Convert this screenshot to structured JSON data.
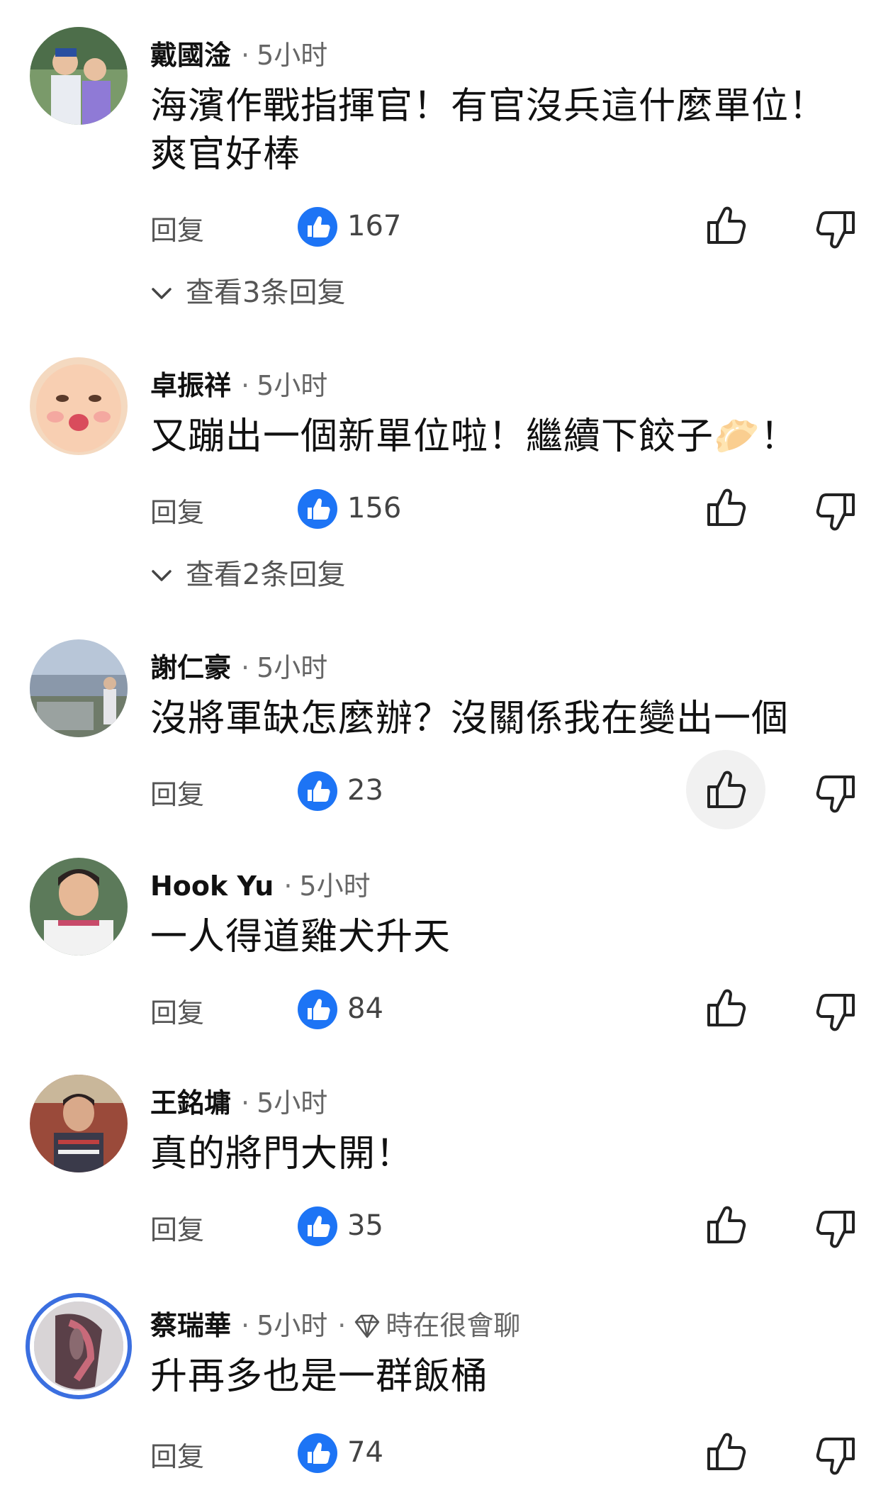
{
  "colors": {
    "like_blue": "#1d74f5",
    "text": "#111111",
    "muted": "#666666",
    "ring_blue": "#3b6fe0"
  },
  "icons": {
    "like_badge": "thumbs-up-badge-icon",
    "thumb_up": "thumb-up-outline-icon",
    "thumb_down": "thumb-down-outline-icon",
    "expand": "chevron-down-icon",
    "badge": "diamond-icon"
  },
  "comments": [
    {
      "author": "戴國淦",
      "time": "5小时",
      "text": "海濱作戰指揮官！有官沒兵這什麼單位！爽官好棒",
      "reply_label": "回复",
      "likes": "167",
      "view_replies": "查看3条回复"
    },
    {
      "author": "卓振祥",
      "time": "5小时",
      "text": "又蹦出一個新單位啦！繼續下餃子🥟！",
      "reply_label": "回复",
      "likes": "156",
      "view_replies": "查看2条回复"
    },
    {
      "author": "謝仁豪",
      "time": "5小时",
      "text": "沒將軍缺怎麼辦？沒關係我在變出一個",
      "reply_label": "回复",
      "likes": "23"
    },
    {
      "author": "Hook Yu",
      "time": "5小时",
      "text": "一人得道雞犬升天",
      "reply_label": "回复",
      "likes": "84"
    },
    {
      "author": "王銘墉",
      "time": "5小时",
      "text": "真的將門大開！",
      "reply_label": "回复",
      "likes": "35"
    },
    {
      "author": "蔡瑞華",
      "time": "5小时",
      "badge": "時在很會聊",
      "text": "升再多也是一群飯桶",
      "reply_label": "回复",
      "likes": "74"
    }
  ]
}
